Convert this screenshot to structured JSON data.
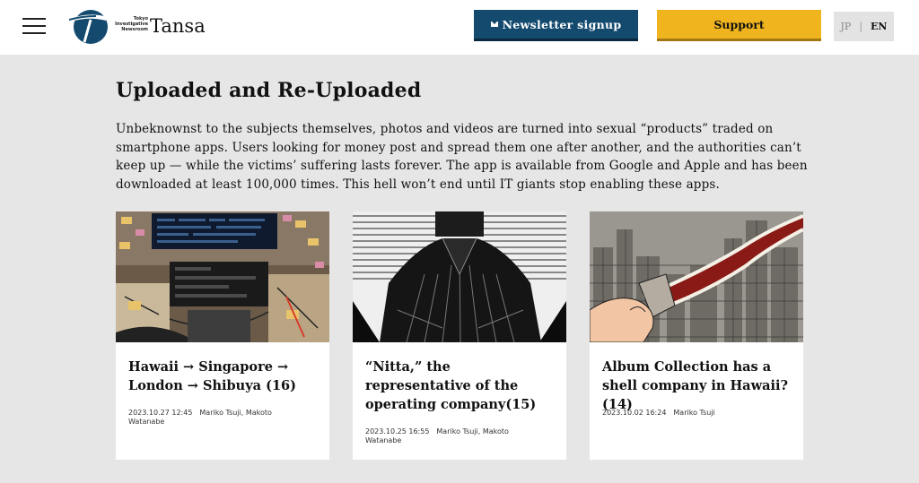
{
  "header": {
    "logo": {
      "sub_line1": "Tokyo",
      "sub_line2": "Investigative",
      "sub_line3": "Newsroom",
      "name": "Tansa"
    },
    "newsletter_label": "Newsletter signup",
    "support_label": "Support",
    "lang": {
      "jp": "JP",
      "separator": "|",
      "en": "EN"
    }
  },
  "main": {
    "title": "Uploaded and Re-Uploaded",
    "intro": "Unbeknownst to the subjects themselves, photos and videos are turned into sexual “products” traded on smartphone apps. Users looking for money post and spread them one after another, and the authorities can’t keep up — while the victims’ suffering lasts forever. The app is available from Google and Apple and has been downloaded at least 100,000 times. This hell won’t end until IT giants stop enabling these apps."
  },
  "articles": [
    {
      "title": "Hawaii → Singapore → London → Shibuya (16)",
      "date": "2023.10.27 12:45",
      "authors": "Mariko Tsuji, Makoto Watanabe"
    },
    {
      "title": "“Nitta,” the representative of the operating company(15)",
      "date": "2023.10.25 16:55",
      "authors": "Mariko Tsuji, Makoto Watanabe"
    },
    {
      "title": "Album Collection has a shell company in Hawaii? (14)",
      "date": "2023.10.02 16:24",
      "authors": "Mariko Tsuji"
    }
  ],
  "colors": {
    "background": "#e6e6e6",
    "newsletter_bg": "#134a6e",
    "support_bg": "#f0b41f"
  }
}
